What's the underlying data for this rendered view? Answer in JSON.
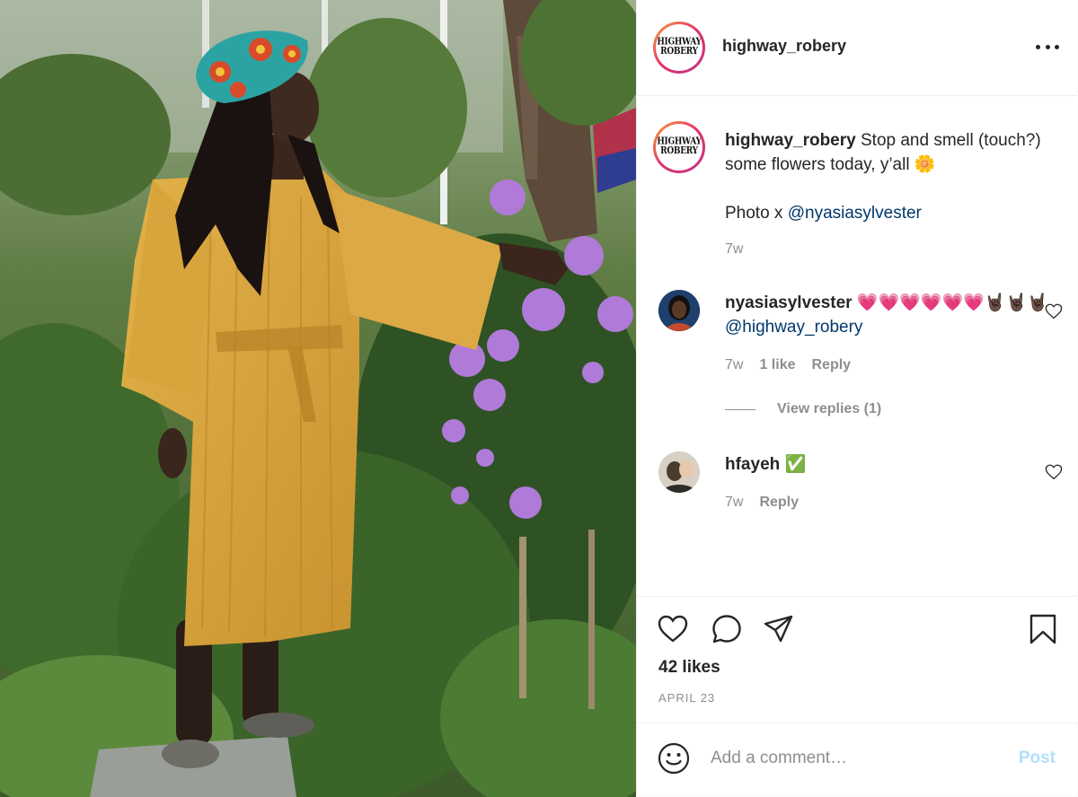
{
  "post": {
    "author": "highway_robery",
    "logo_lines": [
      "HIGHWAY",
      "ROBERY"
    ]
  },
  "caption": {
    "author": "highway_robery",
    "text": "Stop and smell (touch?) some flowers today, y’all 🌼",
    "photo_prefix": "Photo x ",
    "photo_mention": "@nyasiasylvester",
    "time": "7w"
  },
  "comments": [
    {
      "author": "nyasiasylvester",
      "text": "💗💗💗💗💗💗🤘🏿🤘🏿🤘🏿",
      "mention": "@highway_robery",
      "time": "7w",
      "likes": "1 like",
      "reply_label": "Reply",
      "view_replies": "View replies (1)"
    },
    {
      "author": "hfayeh",
      "text": "✅",
      "time": "7w",
      "reply_label": "Reply"
    }
  ],
  "engagement": {
    "likes": "42 likes",
    "date": "APRIL 23"
  },
  "composer": {
    "placeholder": "Add a comment…",
    "post_label": "Post"
  },
  "colors": {
    "link": "#00376b",
    "muted": "#8e8e8e",
    "post_button_disabled": "#b2dffc",
    "avatar_ring": "#e1306c"
  }
}
